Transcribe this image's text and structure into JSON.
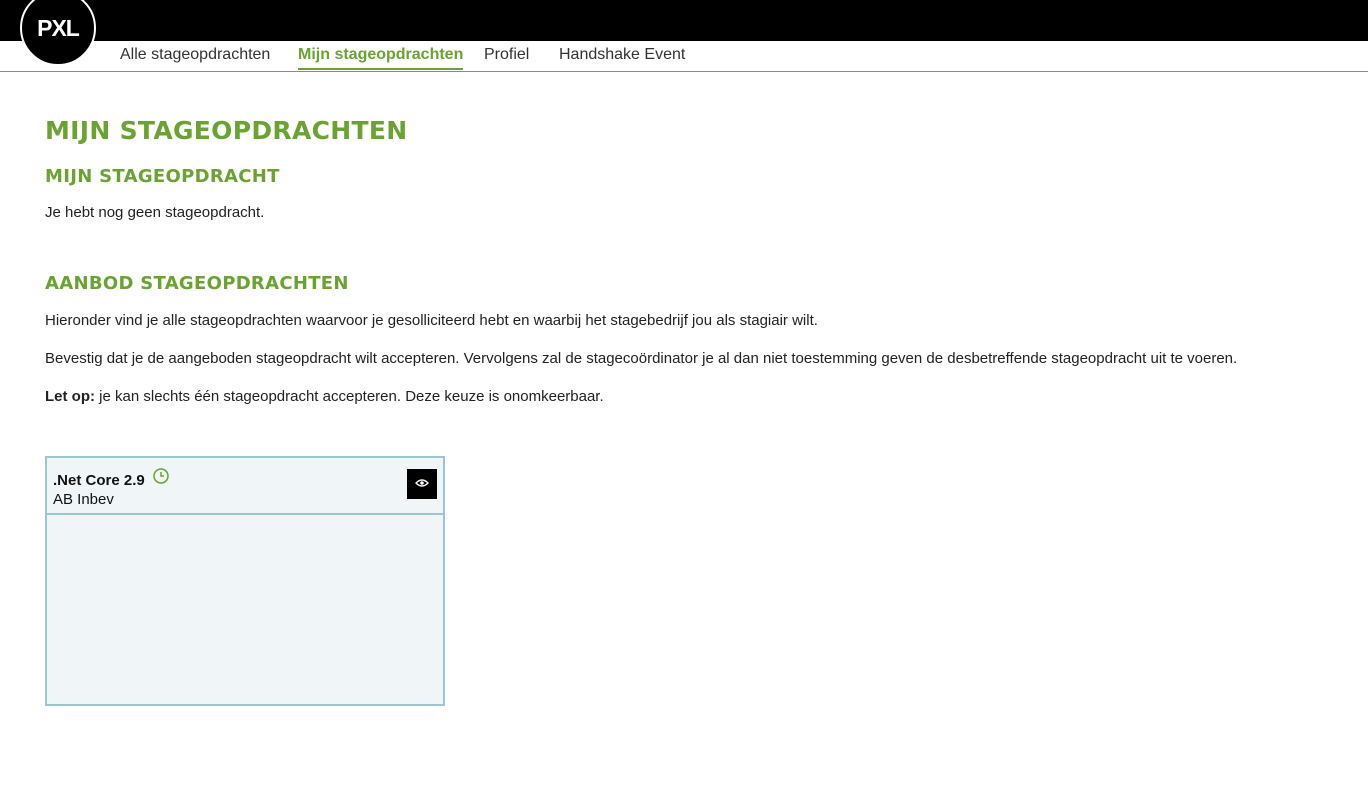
{
  "header": {
    "logo_text": "PXL",
    "nav": [
      {
        "label": "Alle stageopdrachten"
      },
      {
        "label": "Mijn stageopdrachten"
      },
      {
        "label": "Profiel"
      },
      {
        "label": "Handshake Event"
      }
    ],
    "active_nav": "Mijn stageopdrachten"
  },
  "page": {
    "title": "MIJN STAGEOPDRACHTEN",
    "section1": {
      "title": "MIJN STAGEOPDRACHT",
      "text": "Je hebt nog geen stageopdracht."
    },
    "section2": {
      "title": "AANBOD STAGEOPDRACHTEN",
      "text1": "Hieronder vind je alle stageopdrachten waarvoor je gesolliciteerd hebt en waarbij het stagebedrijf jou als stagiair wilt.",
      "text2": "Bevestig dat je de aangeboden stageopdracht wilt accepteren. Vervolgens zal de stagecoördinator je al dan niet toestemming geven de desbetreffende stageopdracht uit te voeren.",
      "note_label": "Let op:",
      "note_text": " je kan slechts één stageopdracht accepteren. Deze keuze is onomkeerbaar."
    }
  },
  "card": {
    "title": ".Net Core 2.9",
    "company": "AB Inbev",
    "status_icon": "clock-icon",
    "action_icon": "eye-icon"
  },
  "colors": {
    "accent": "#6aa332",
    "card_border": "#9ac7d3",
    "card_bg": "#f0f6f8",
    "topbar": "#000000"
  }
}
